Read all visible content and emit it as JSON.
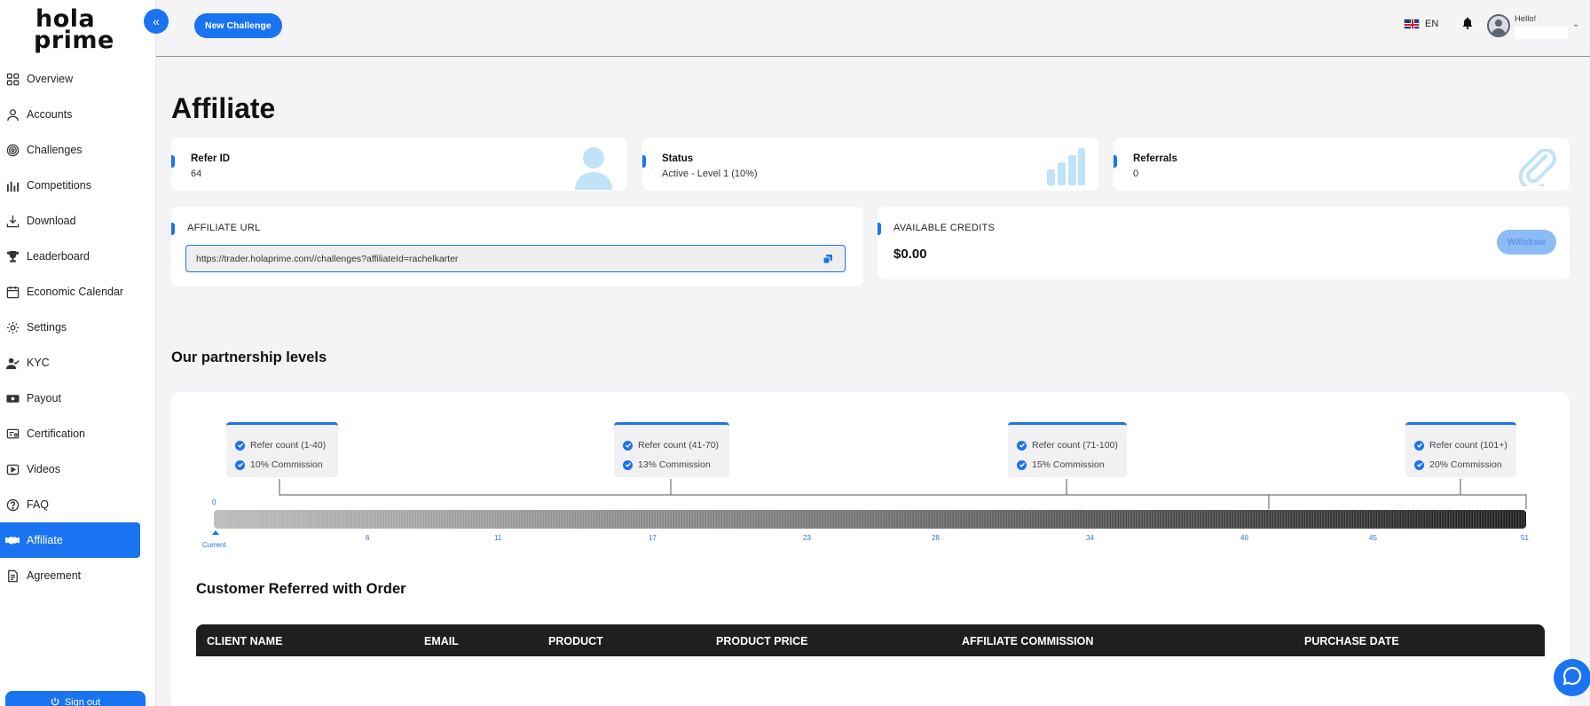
{
  "brand": {
    "line1": "hola",
    "line2": "prime"
  },
  "sidebar": {
    "items": [
      {
        "label": "Overview",
        "icon": "grid-icon"
      },
      {
        "label": "Accounts",
        "icon": "user-icon"
      },
      {
        "label": "Challenges",
        "icon": "target-icon"
      },
      {
        "label": "Competitions",
        "icon": "bar-chart-icon"
      },
      {
        "label": "Download",
        "icon": "download-icon"
      },
      {
        "label": "Leaderboard",
        "icon": "trophy-icon"
      },
      {
        "label": "Economic Calendar",
        "icon": "calendar-icon"
      },
      {
        "label": "Settings",
        "icon": "gear-icon"
      },
      {
        "label": "KYC",
        "icon": "user-check-icon"
      },
      {
        "label": "Payout",
        "icon": "cash-icon"
      },
      {
        "label": "Certification",
        "icon": "certificate-icon"
      },
      {
        "label": "Videos",
        "icon": "play-icon"
      },
      {
        "label": "FAQ",
        "icon": "question-icon"
      },
      {
        "label": "Affiliate",
        "icon": "handshake-icon",
        "active": true
      },
      {
        "label": "Agreement",
        "icon": "document-icon"
      }
    ],
    "signout_label": "Sign out"
  },
  "header": {
    "new_challenge_label": "New Challenge",
    "language": "EN",
    "greeting": "Hello!"
  },
  "page": {
    "title": "Affiliate"
  },
  "stats": [
    {
      "label": "Refer ID",
      "value": "64",
      "icon": "person-icon"
    },
    {
      "label": "Status",
      "value": "Active - Level 1 (10%)",
      "icon": "bar-chart-icon"
    },
    {
      "label": "Referrals",
      "value": "0",
      "icon": "paperclip-icon"
    }
  ],
  "affiliate_url": {
    "label": "AFFILIATE URL",
    "value": "https://trader.holaprime.com//challenges?affiliateId=rachelkarter"
  },
  "credits": {
    "label": "AVAILABLE CREDITS",
    "value": "$0.00",
    "withdraw_label": "Withdraw"
  },
  "partnership": {
    "title": "Our partnership levels",
    "levels": [
      {
        "refer": "Refer count (1-40)",
        "commission": "10% Commission"
      },
      {
        "refer": "Refer count (41-70)",
        "commission": "13% Commission"
      },
      {
        "refer": "Refer count (71-100)",
        "commission": "15% Commission"
      },
      {
        "refer": "Refer count (101+)",
        "commission": "20% Commission"
      }
    ],
    "scale_start": "0",
    "ticks": [
      "6",
      "11",
      "17",
      "23",
      "28",
      "34",
      "40",
      "45",
      "51"
    ],
    "current_label": "Current",
    "current_value": 0
  },
  "orders": {
    "title": "Customer Referred with Order",
    "columns": [
      "CLIENT NAME",
      "EMAIL",
      "PRODUCT",
      "PRODUCT PRICE",
      "AFFILIATE COMMISSION",
      "PURCHASE DATE"
    ]
  },
  "colors": {
    "accent": "#1a73f0",
    "table_header": "#1f1f1f",
    "icon_light": "#bfe3f7"
  }
}
